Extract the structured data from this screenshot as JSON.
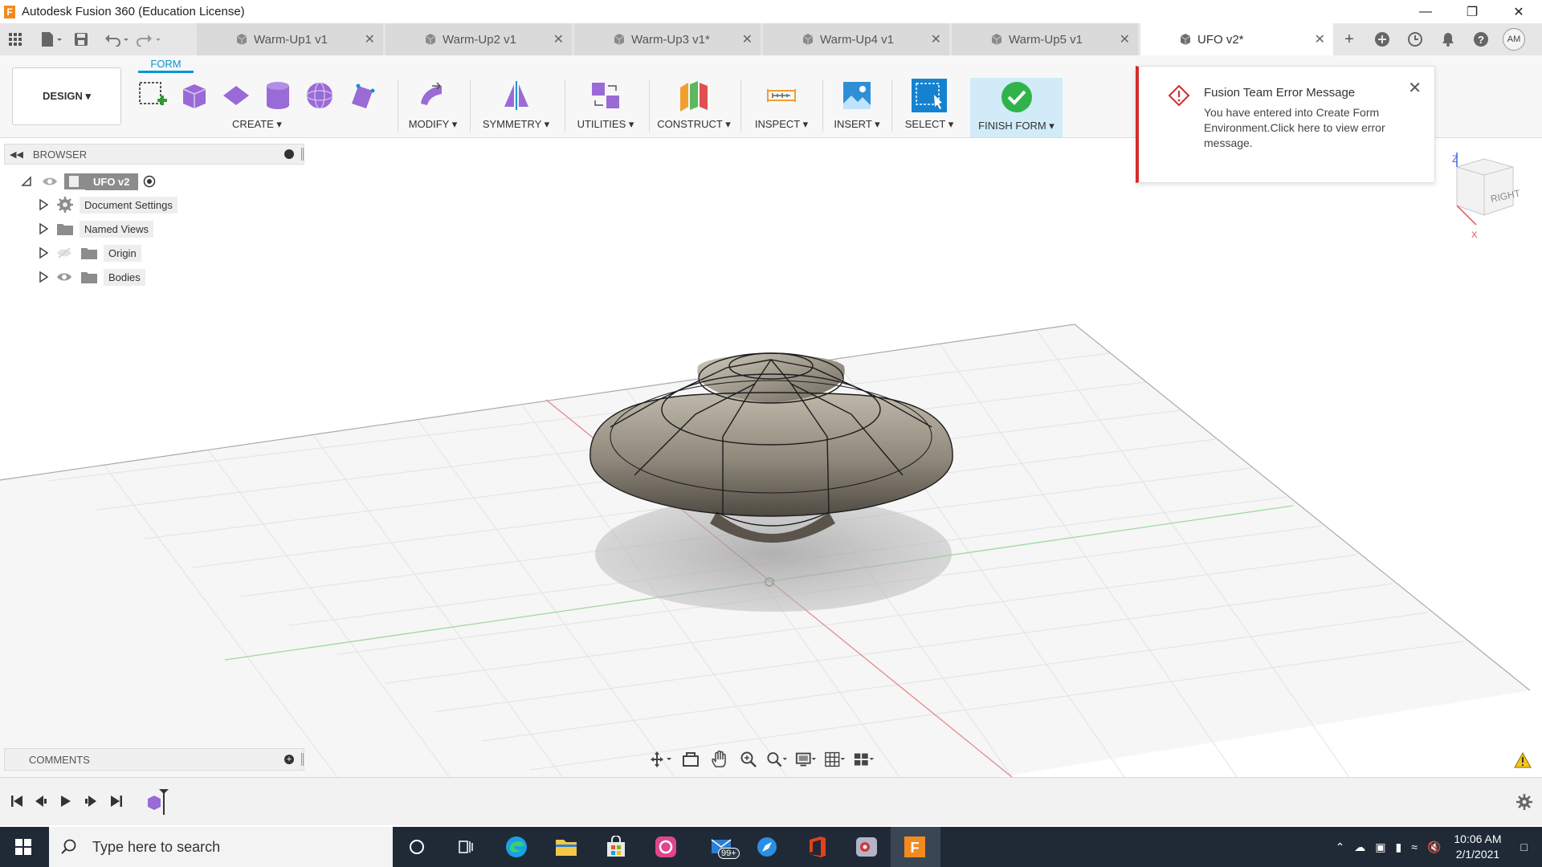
{
  "window": {
    "title": "Autodesk Fusion 360 (Education License)",
    "logo_letter": "F"
  },
  "tabs": [
    {
      "label": "Warm-Up1 v1"
    },
    {
      "label": "Warm-Up2 v1"
    },
    {
      "label": "Warm-Up3 v1*"
    },
    {
      "label": "Warm-Up4 v1"
    },
    {
      "label": "Warm-Up5 v1"
    },
    {
      "label": "UFO v2*",
      "active": true
    }
  ],
  "user": {
    "initials": "AM"
  },
  "toolbar": {
    "workspace": "DESIGN ▾",
    "active_tab": "FORM",
    "groups": {
      "create": "CREATE ▾",
      "modify": "MODIFY ▾",
      "symmetry": "SYMMETRY ▾",
      "utilities": "UTILITIES ▾",
      "construct": "CONSTRUCT ▾",
      "inspect": "INSPECT ▾",
      "insert": "INSERT ▾",
      "select": "SELECT ▾",
      "finish": "FINISH FORM ▾"
    }
  },
  "browser": {
    "header": "BROWSER",
    "root": "UFO v2",
    "items": [
      {
        "label": "Document Settings"
      },
      {
        "label": "Named Views"
      },
      {
        "label": "Origin"
      },
      {
        "label": "Bodies"
      }
    ]
  },
  "toast": {
    "title": "Fusion Team Error Message",
    "body": "You have entered into Create Form Environment.Click here to view error message."
  },
  "viewcube": {
    "face": "RIGHT",
    "axis_z": "Z",
    "axis_x": "X"
  },
  "comments": {
    "header": "COMMENTS"
  },
  "taskbar": {
    "search_placeholder": "Type here to search",
    "mail_badge": "99+",
    "time": "10:06 AM",
    "date": "2/1/2021"
  },
  "colors": {
    "accent": "#0696d7",
    "error": "#d42b2b",
    "finish_bg": "#d1ebf8",
    "taskbar": "#1f2a36"
  }
}
